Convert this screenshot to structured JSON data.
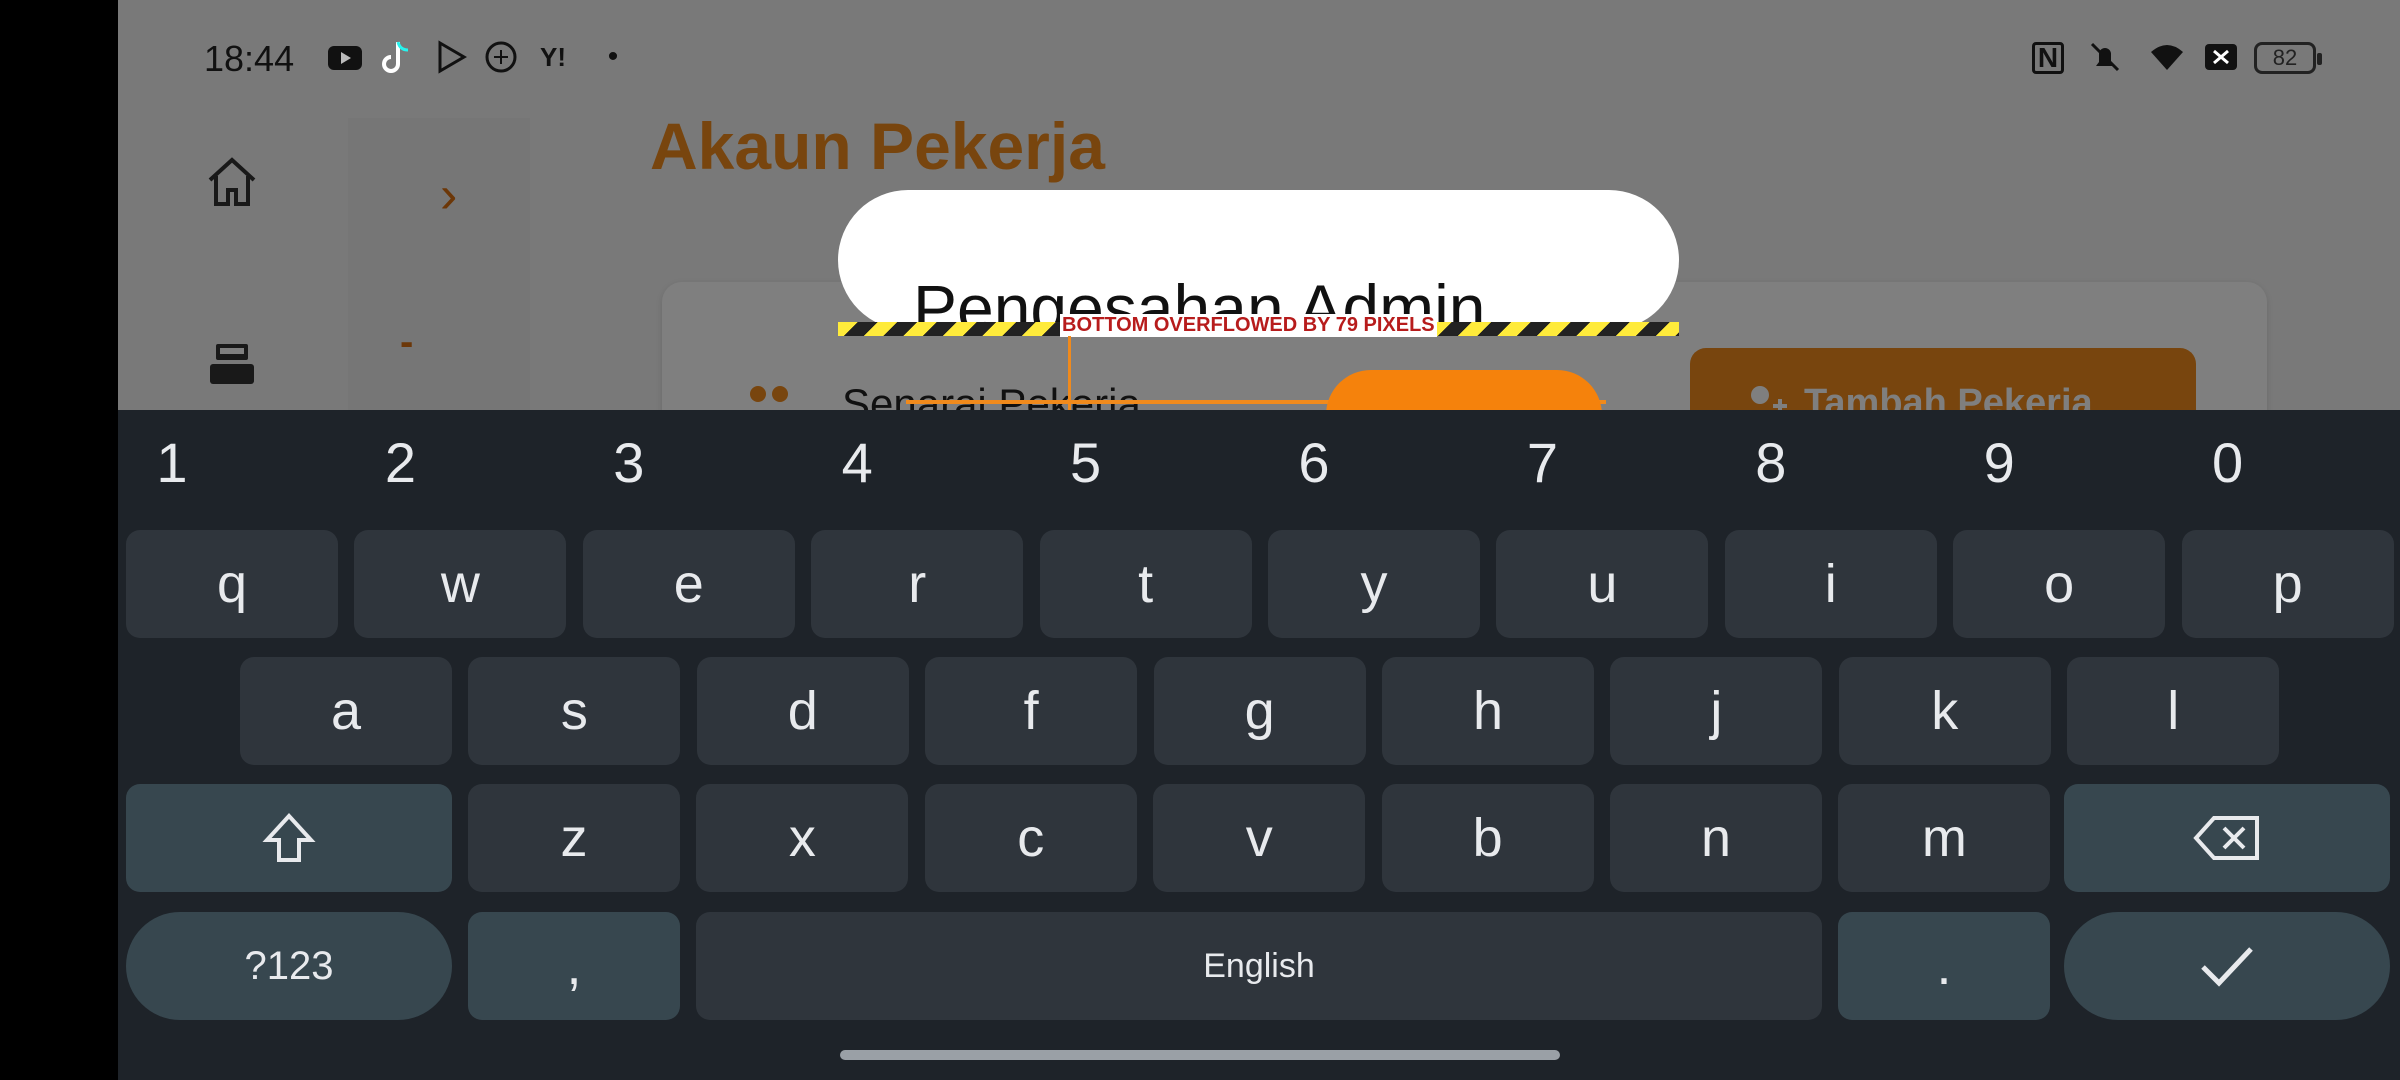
{
  "status_bar": {
    "time": "18:44",
    "left_icons": [
      "youtube-icon",
      "tiktok-icon",
      "play-store-icon",
      "chatgpt-icon",
      "yahoo-icon",
      "dot-icon"
    ],
    "right_icons": [
      "nfc-icon",
      "mute-icon",
      "wifi-icon",
      "x-icon"
    ],
    "battery": "82"
  },
  "nav_rail": {
    "items": [
      "home-icon",
      "cash-register-icon"
    ]
  },
  "page": {
    "title": "Akaun Pekerja",
    "list_title": "Senarai Pekerja",
    "add_button": "Tambah Pekerja"
  },
  "dialog": {
    "title": "Pengesahan Admin",
    "overflow_text": "BOTTOM OVERFLOWED BY 79 PIXELS"
  },
  "keyboard": {
    "number_row": [
      "1",
      "2",
      "3",
      "4",
      "5",
      "6",
      "7",
      "8",
      "9",
      "0"
    ],
    "row1": [
      "q",
      "w",
      "e",
      "r",
      "t",
      "y",
      "u",
      "i",
      "o",
      "p"
    ],
    "row2": [
      "a",
      "s",
      "d",
      "f",
      "g",
      "h",
      "j",
      "k",
      "l"
    ],
    "row3": [
      "z",
      "x",
      "c",
      "v",
      "b",
      "n",
      "m"
    ],
    "symbols_key": "?123",
    "comma_key": ",",
    "space_key": "English",
    "period_key": "."
  },
  "colors": {
    "accent": "#f08a1c",
    "keyboard_bg": "#1e2329",
    "key_bg": "#2f353c",
    "mod_key_bg": "#37474f"
  }
}
